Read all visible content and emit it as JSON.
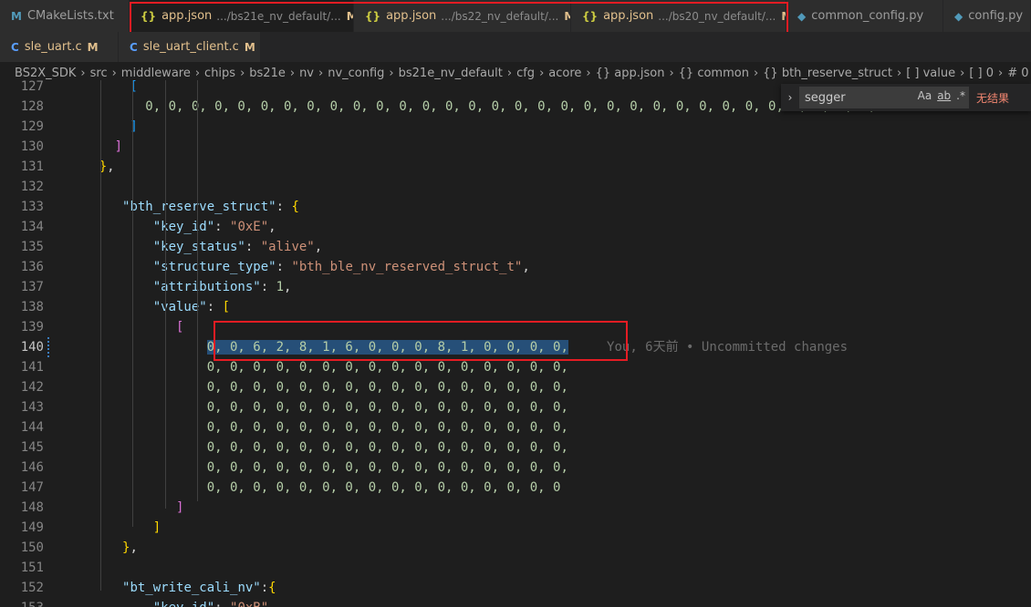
{
  "tabs_row1": [
    {
      "icon": "M",
      "label": "CMakeLists.txt",
      "desc": "",
      "modified": ""
    },
    {
      "icon": "{}",
      "label": "app.json",
      "desc": ".../bs21e_nv_default/...",
      "modified": "M",
      "close": "×"
    },
    {
      "icon": "{}",
      "label": "app.json",
      "desc": ".../bs22_nv_default/...",
      "modified": "M",
      "close": "×"
    },
    {
      "icon": "{}",
      "label": "app.json",
      "desc": ".../bs20_nv_default/...",
      "modified": "M"
    },
    {
      "icon": "py",
      "label": "common_config.py"
    },
    {
      "icon": "py",
      "label": "config.py"
    }
  ],
  "tabs_row2": [
    {
      "icon": "C",
      "label": "sle_uart.c",
      "modified": "M"
    },
    {
      "icon": "C",
      "label": "sle_uart_client.c",
      "modified": "M"
    }
  ],
  "breadcrumb": [
    "BS2X_SDK",
    "src",
    "middleware",
    "chips",
    "bs21e",
    "nv",
    "nv_config",
    "bs21e_nv_default",
    "cfg",
    "acore",
    "{} app.json",
    "{} common",
    "{} bth_reserve_struct",
    "[ ] value",
    "[ ] 0",
    "# 0"
  ],
  "find": {
    "query": "segger",
    "match_case": "Aa",
    "whole_word": "ab",
    "regex": ".*",
    "result": "无结果"
  },
  "blame": "You, 6天前 • Uncommitted changes",
  "colors": {
    "accent_red": "#e51c23",
    "selection": "#264f78"
  }
}
